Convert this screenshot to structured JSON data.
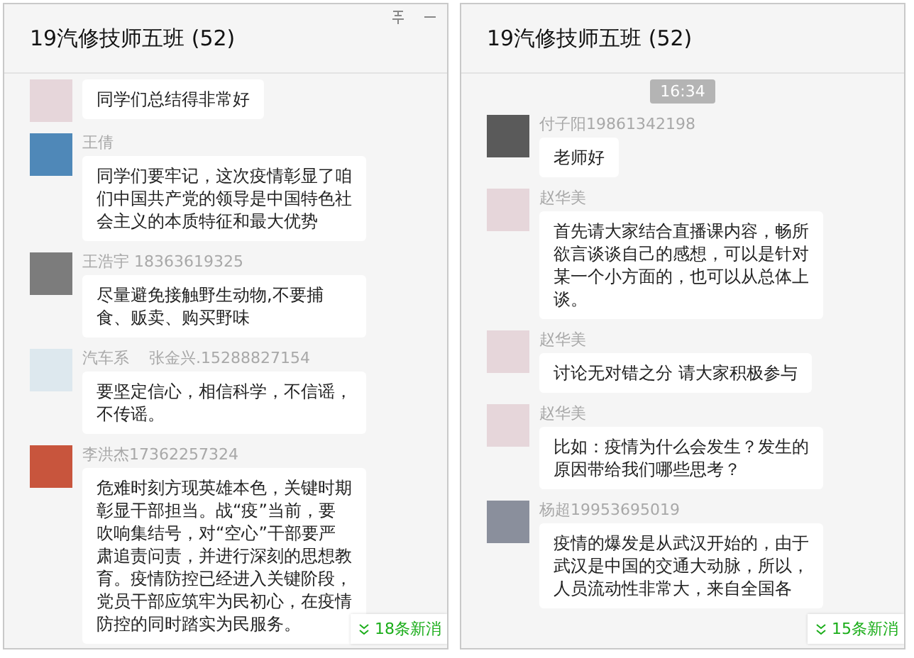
{
  "panels": [
    {
      "title": "19汽修技师五班 (52)",
      "window_controls": true,
      "new_messages": "18条新消",
      "messages": [
        {
          "text": "同学们总结得非常好",
          "color": "#e6d6da"
        },
        {
          "sender": "王倩",
          "text": "同学们要牢记，这次疫情彰显了咱们中国共产党的领导是中国特色社会主义的本质特征和最大优势",
          "color": "#4f88b8"
        },
        {
          "sender": "王浩宇 18363619325",
          "text": "尽量避免接触野生动物,不要捕食、贩卖、购买野味",
          "color": "#7c7c7c"
        },
        {
          "tag": "汽车系",
          "sender": "张金兴.15288827154",
          "text": "要坚定信心，相信科学，不信谣，不传谣。",
          "color": "#dde8ee"
        },
        {
          "sender": "李洪杰17362257324",
          "text": "危难时刻方现英雄本色，关键时期彰显干部担当。战“疫”当前，要吹响集结号，对“空心”干部要严肃追责问责，并进行深刻的思想教育。疫情防控已经进入关键阶段，党员干部应筑牢为民初心，在疫情防控的同时踏实为民服务。",
          "color": "#c8553d"
        }
      ]
    },
    {
      "title": "19汽修技师五班 (52)",
      "window_controls": false,
      "time": "16:34",
      "new_messages": "15条新消",
      "messages": [
        {
          "sender": "付子阳19861342198",
          "text": "老师好",
          "color": "#5a5a5a"
        },
        {
          "sender": "赵华美",
          "text": "首先请大家结合直播课内容，畅所欲言谈谈自己的感想，可以是针对某一个小方面的，也可以从总体上谈。",
          "color": "#e6d6da"
        },
        {
          "sender": "赵华美",
          "text": "讨论无对错之分 请大家积极参与",
          "color": "#e6d6da"
        },
        {
          "sender": "赵华美",
          "text": "比如：疫情为什么会发生？发生的原因带给我们哪些思考？",
          "color": "#e6d6da"
        },
        {
          "sender": "杨超19953695019",
          "text": "疫情的爆发是从武汉开始的，由于武汉是中国的交通大动脉，所以，人员流动性非常大，来自全国各",
          "color": "#8a8f9c"
        }
      ]
    }
  ]
}
